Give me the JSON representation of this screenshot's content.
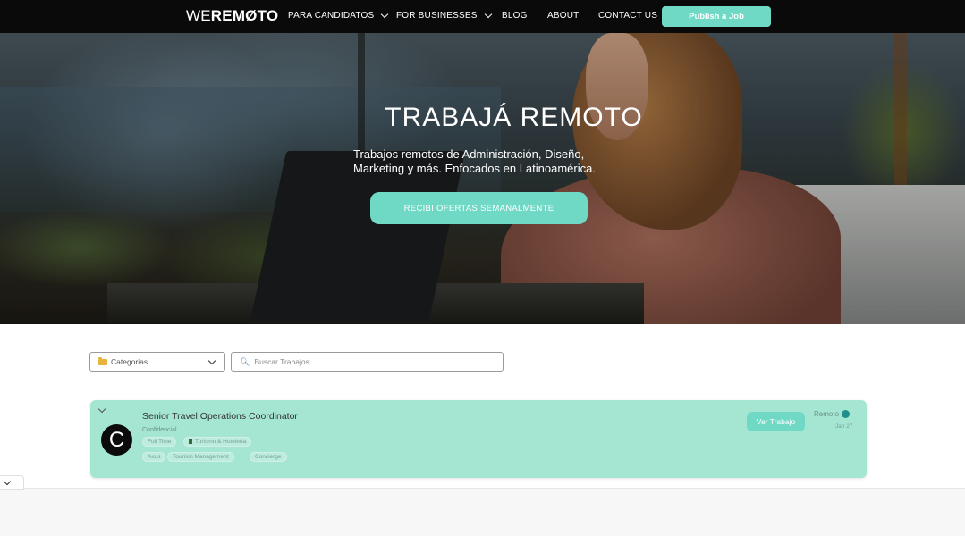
{
  "nav": {
    "logo_prefix": "WE",
    "logo_rest": "REMØTO",
    "items": [
      {
        "label": "PARA CANDIDATOS"
      },
      {
        "label": "FOR BUSINESSES"
      },
      {
        "label": "BLOG"
      },
      {
        "label": "ABOUT"
      },
      {
        "label": "CONTACT US"
      }
    ],
    "publish_label": "Publish a Job"
  },
  "hero": {
    "title": "TRABAJÁ REMOTO",
    "subtitle_line1": "Trabajos remotos de Administración, Diseño,",
    "subtitle_line2": "Marketing y más. Enfocados en Latinoamérica.",
    "cta_label": "RECIBI OFERTAS SEMANALMENTE"
  },
  "filters": {
    "category_placeholder": "Categorias",
    "search_placeholder": "Buscar Trabajos"
  },
  "jobs": [
    {
      "logo_letter": "C",
      "title": "Senior Travel Operations Coordinator",
      "company": "Confidencial",
      "type": "Full Time",
      "category": "Turismo & Hoteleria",
      "skills": [
        "Axus",
        "Tourism Management",
        "Concierge"
      ],
      "view_label": "Ver Trabajo",
      "location": "Remoto",
      "date": "Jan 27"
    }
  ],
  "colors": {
    "accent": "#6fd9c6",
    "card_bg": "#a5e6d3",
    "nav_bg": "#0a0a0a"
  }
}
